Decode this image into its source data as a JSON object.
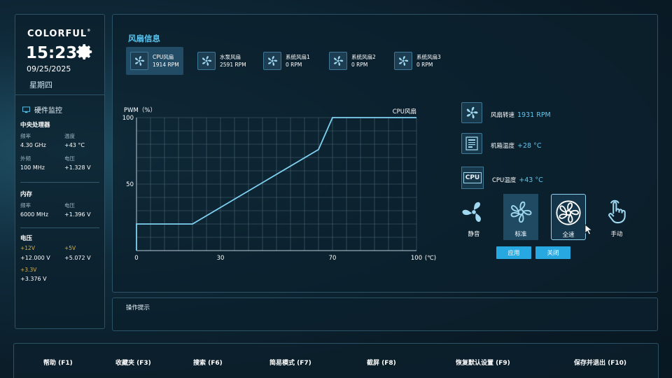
{
  "brand": {
    "name": "COLORFUL",
    "mark": "®"
  },
  "clock": {
    "time": "15:23",
    "date": "09/25/2025",
    "weekday": "星期四"
  },
  "hardware": {
    "title": "硬件监控",
    "cpu": {
      "title": "中央处理器",
      "freq_label": "频率",
      "freq": "4.30 GHz",
      "temp_label": "温度",
      "temp": "+43 °C",
      "ext_label": "外频",
      "ext": "100 MHz",
      "volt_label": "电压",
      "volt": "+1.328 V"
    },
    "memory": {
      "title": "内存",
      "freq_label": "频率",
      "freq": "6000 MHz",
      "volt_label": "电压",
      "volt": "+1.396 V"
    },
    "voltage": {
      "title": "电压",
      "v12_label": "+12V",
      "v12": "+12.000 V",
      "v5_label": "+5V",
      "v5": "+5.072 V",
      "v33_label": "+3.3V",
      "v33": "+3.376 V"
    }
  },
  "fan_info": {
    "title": "风扇信息",
    "tabs": [
      {
        "name": "CPU风扇",
        "rpm": "1914 RPM",
        "active": true
      },
      {
        "name": "水泵风扇",
        "rpm": "2591 RPM",
        "active": false
      },
      {
        "name": "系统风扇1",
        "rpm": "0 RPM",
        "active": false
      },
      {
        "name": "系统风扇2",
        "rpm": "0 RPM",
        "active": false
      },
      {
        "name": "系统风扇3",
        "rpm": "0 RPM",
        "active": false
      }
    ]
  },
  "chart_data": {
    "type": "line",
    "series_label": "CPU风扇",
    "ylabel": "PWM（%）",
    "xlabel_unit": "(℃)",
    "x_ticks": [
      "0",
      "30",
      "70",
      "100"
    ],
    "y_ticks": [
      "50",
      "100"
    ],
    "xlim": [
      0,
      100
    ],
    "ylim": [
      0,
      100
    ],
    "grid": true,
    "points": [
      [
        0,
        20
      ],
      [
        20,
        20
      ],
      [
        65,
        76
      ],
      [
        70,
        100
      ],
      [
        100,
        100
      ]
    ]
  },
  "status": {
    "fan_speed_label": "风扇转速",
    "fan_speed": "1931 RPM",
    "case_temp_label": "机箱温度",
    "case_temp": "+28 °C",
    "cpu_badge": "CPU",
    "cpu_temp_label": "CPU温度",
    "cpu_temp": "+43 °C"
  },
  "modes": [
    {
      "label": "静音",
      "state": "normal"
    },
    {
      "label": "标准",
      "state": "selected"
    },
    {
      "label": "全速",
      "state": "outlined"
    },
    {
      "label": "手动",
      "state": "normal"
    }
  ],
  "actions": {
    "apply": "应用",
    "close": "关闭"
  },
  "hint": {
    "label": "操作提示"
  },
  "function_keys": [
    "帮助 (F1)",
    "收藏夹 (F3)",
    "搜索 (F6)",
    "简易模式 (F7)",
    "截屏 (F8)",
    "恢复默认设置 (F9)",
    "保存并退出 (F10)"
  ],
  "colors": {
    "accent": "#59c4ee",
    "button": "#27a8e0",
    "curve": "#7fd2f2",
    "voltage_label": "#d6b24a"
  }
}
